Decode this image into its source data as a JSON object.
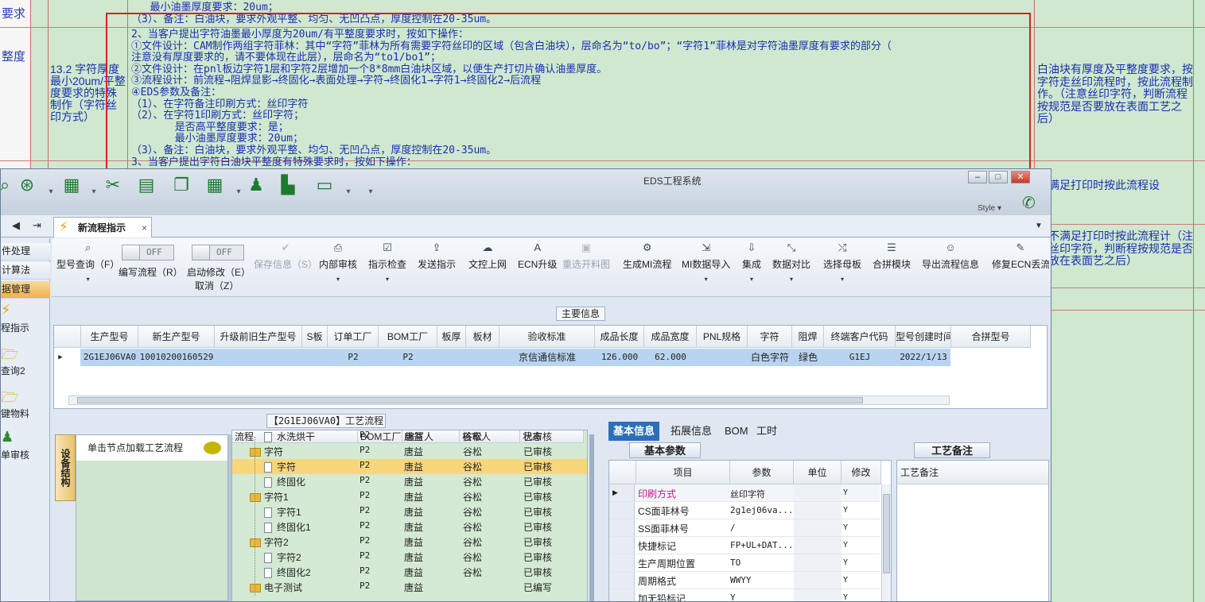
{
  "doc": {
    "left_col": [
      "要求",
      "整度"
    ],
    "row_top_lines": [
      "   最小油墨厚度要求：20um；",
      "（3）、备注：白油块，要求外观平整、均匀、无凹凸点，厚度控制在20-35um。"
    ],
    "row_label": "13.2 字符厚度最小20um/平整度要求的特殊制作（字符丝印方式）",
    "lines": [
      "2、当客户提出字符油墨最小厚度为20um/有平整度要求时，按如下操作：",
      "①文件设计：CAM制作两组字符菲林：其中“字符”菲林为所有需要字符丝印的区域（包含白油块），层命名为“to/bo”；“字符1”菲林是对字符油墨厚度有要求的部分（",
      "注意没有厚度要求的，请不要体现在此层），层命名为“to1/bo1”；",
      "②文件设计：在pnl板边字符1层和字符2层增加一个8*8mm白油块区域，以便生产打切片确认油墨厚度。",
      "③流程设计：前流程→阻焊显影→终固化→表面处理→字符→终固化1→字符1→终固化2→后流程",
      "④EDS参数及备注：",
      "（1）、在字符备注印刷方式：丝印字符",
      "（2）、在字符1印刷方式：丝印字符；",
      "       是否高平整度要求：是；",
      "       最小油墨厚度要求：20um；",
      "（3）、备注：白油块，要求外观平整、均匀、无凹凸点，厚度控制在20-35um。",
      "3、当客户提出字符白油块平整度有特殊要求时，按如下操作："
    ],
    "note_main": "白油块有厚度及平整度要求，按字符走丝印流程时，按此流程制作。（注意丝印字符，判断流程按规范是否要放在表面工艺之后）",
    "note_2": "符满足打印时按此流程设",
    "note_3": "符不满足打印时按此流程计（注意丝印字符，判断程按规范是否要放在表面艺之后）"
  },
  "window": {
    "title": "EDS工程系统",
    "style_label": "Style",
    "tab_label": "新流程指示",
    "tab_close": "×"
  },
  "left_nav": {
    "items": [
      "件处理",
      "计算法",
      "据管理"
    ],
    "big_items": [
      "程指示",
      "查询2",
      "键物料",
      "单审核"
    ]
  },
  "ribbon": {
    "model_query": "型号查询（F）",
    "edit_flow": "编写流程（R）",
    "edit_flow_toggle": "OFF",
    "start_modify": "启动修改（E）",
    "start_modify_toggle": "OFF",
    "cancel": "取消（Z）",
    "save_info": "保存信息（S）",
    "internal_review": "内部审核",
    "instruction_check": "指示检查",
    "send_instruction": "发送指示",
    "upload_docs": "文控上网",
    "ecn_upgrade": "ECN升级",
    "reselect_chart": "重选开料图",
    "generate_mi": "生成MI流程",
    "mi_import": "MI数据导入",
    "integrate": "集成",
    "data_compare": "数据对比",
    "select_master": "选择母板",
    "combine_module": "合拼模块",
    "export_flow": "导出流程信息",
    "repair_ecn": "修复ECN丢流"
  },
  "main_info": {
    "header": "主要信息",
    "columns": [
      "生产型号",
      "新生产型号",
      "升级前旧生产型号",
      "S板",
      "订单工厂",
      "BOM工厂",
      "板厚",
      "板材",
      "验收标准",
      "成品长度",
      "成品宽度",
      "PNL规格",
      "字符",
      "阻焊",
      "终端客户代码",
      "型号创建时间",
      "合拼型号"
    ],
    "row": [
      "2G1EJ06VA0",
      "10010200160529",
      "",
      "",
      "P2",
      "P2",
      "",
      "",
      "京信通信标准",
      "126.000",
      "62.000",
      "",
      "白色字符",
      "绿色",
      "G1EJ",
      "2022/1/13",
      ""
    ]
  },
  "flow": {
    "title": "【2G1EJ06VA0】工艺流程",
    "side_tab": "设备结构",
    "load_hint": "单击节点加载工艺流程",
    "columns": [
      "流程",
      "BOM工厂",
      "编写人",
      "核审人",
      "状态"
    ],
    "rows": [
      {
        "name": "水洗烘干",
        "bom": "P2",
        "writer": "唐益",
        "reviewer": "谷松",
        "status": "已审核",
        "kind": "file",
        "level": 2
      },
      {
        "name": "字符",
        "bom": "P2",
        "writer": "唐益",
        "reviewer": "谷松",
        "status": "已审核",
        "kind": "folder",
        "level": 1
      },
      {
        "name": "字符",
        "bom": "P2",
        "writer": "唐益",
        "reviewer": "谷松",
        "status": "已审核",
        "kind": "file",
        "level": 2
      },
      {
        "name": "终固化",
        "bom": "P2",
        "writer": "唐益",
        "reviewer": "谷松",
        "status": "已审核",
        "kind": "file",
        "level": 2
      },
      {
        "name": "字符1",
        "bom": "P2",
        "writer": "唐益",
        "reviewer": "谷松",
        "status": "已审核",
        "kind": "folder",
        "level": 1
      },
      {
        "name": "字符1",
        "bom": "P2",
        "writer": "唐益",
        "reviewer": "谷松",
        "status": "已审核",
        "kind": "file",
        "level": 2
      },
      {
        "name": "终固化1",
        "bom": "P2",
        "writer": "唐益",
        "reviewer": "谷松",
        "status": "已审核",
        "kind": "file",
        "level": 2
      },
      {
        "name": "字符2",
        "bom": "P2",
        "writer": "唐益",
        "reviewer": "谷松",
        "status": "已审核",
        "kind": "folder",
        "level": 1
      },
      {
        "name": "字符2",
        "bom": "P2",
        "writer": "唐益",
        "reviewer": "谷松",
        "status": "已审核",
        "kind": "file",
        "level": 2
      },
      {
        "name": "终固化2",
        "bom": "P2",
        "writer": "唐益",
        "reviewer": "谷松",
        "status": "已审核",
        "kind": "file",
        "level": 2
      },
      {
        "name": "电子测试",
        "bom": "P2",
        "writer": "唐益",
        "reviewer": "",
        "status": "已编写",
        "kind": "folder",
        "level": 1
      }
    ]
  },
  "detail": {
    "tabs": [
      "基本信息",
      "拓展信息",
      "BOM",
      "工时"
    ],
    "subtab_params": "基本参数",
    "subtab_notes": "工艺备注",
    "notes_header": "工艺备注",
    "columns": [
      "项目",
      "参数",
      "单位",
      "修改"
    ],
    "rows": [
      {
        "item": "印刷方式",
        "param": "丝印字符",
        "unit": "",
        "edit": "Y",
        "highlight": true
      },
      {
        "item": "CS面菲林号",
        "param": "2g1ej06va...",
        "unit": "",
        "edit": "Y"
      },
      {
        "item": "SS面菲林号",
        "param": "/",
        "unit": "",
        "edit": "Y"
      },
      {
        "item": "快捷标记",
        "param": "FP+UL+DAT...",
        "unit": "",
        "edit": "Y"
      },
      {
        "item": "生产周期位置",
        "param": "TO",
        "unit": "",
        "edit": "Y"
      },
      {
        "item": "周期格式",
        "param": "WWYY",
        "unit": "",
        "edit": "Y"
      },
      {
        "item": "加无铅标记",
        "param": "Y",
        "unit": "",
        "edit": "Y"
      }
    ]
  },
  "colors": {
    "accent": "#2c6fb8",
    "doc_text": "#1a2fae",
    "highlight_row": "#f8d77a",
    "red_box": "#d62020"
  }
}
